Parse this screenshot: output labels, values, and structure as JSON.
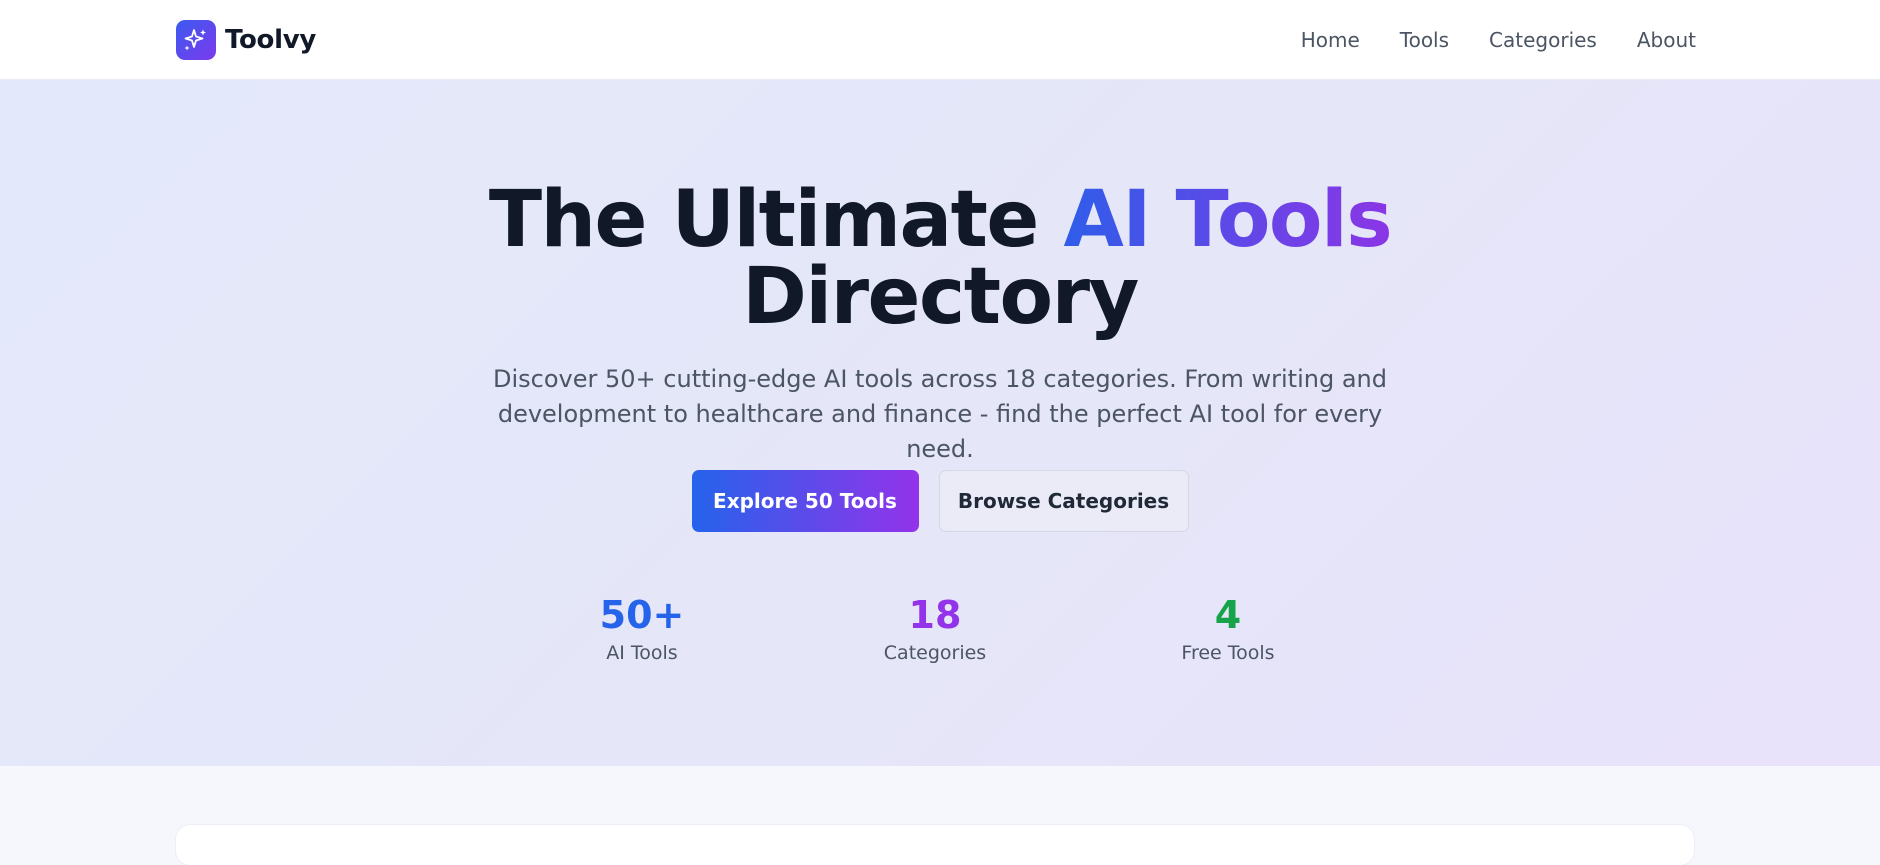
{
  "brand": {
    "name": "Toolvy",
    "logo_icon": "sparkles-icon"
  },
  "nav": {
    "items": [
      "Home",
      "Tools",
      "Categories",
      "About"
    ]
  },
  "hero": {
    "title_part1": "The Ultimate ",
    "title_highlight": "AI Tools",
    "title_part2": "Directory",
    "subtitle": "Discover 50+ cutting-edge AI tools across 18 categories. From writing and development to healthcare and finance - find the perfect AI tool for every need.",
    "primary_button": "Explore 50 Tools",
    "secondary_button": "Browse Categories"
  },
  "stats": [
    {
      "value": "50+",
      "label": "AI Tools",
      "color": "#2563eb"
    },
    {
      "value": "18",
      "label": "Categories",
      "color": "#9333ea"
    },
    {
      "value": "4",
      "label": "Free Tools",
      "color": "#16a34a"
    }
  ],
  "colors": {
    "accent_start": "#2563eb",
    "accent_end": "#9333ea",
    "hero_background": "#e4e8f9",
    "text_primary": "#111827",
    "text_secondary": "#4b5563"
  }
}
